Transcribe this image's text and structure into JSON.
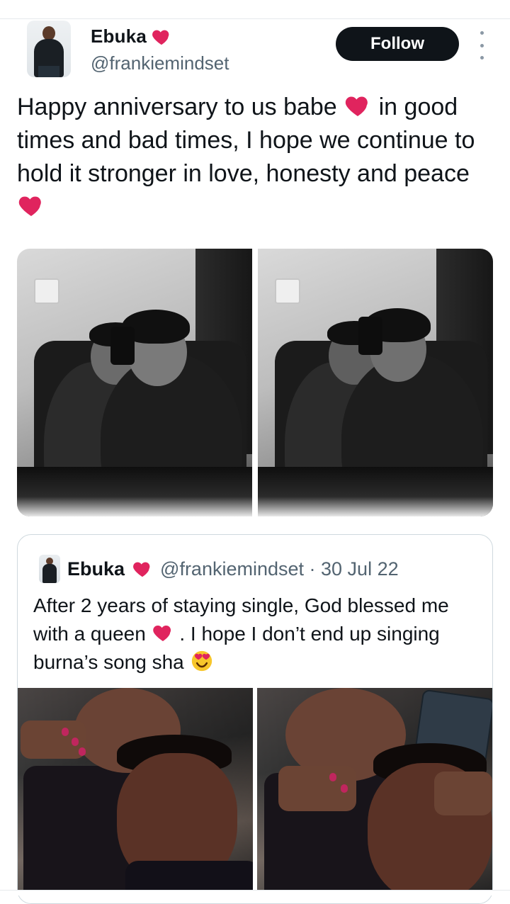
{
  "colors": {
    "heart": "#e0245e",
    "follow_bg": "#0f1419",
    "follow_text": "#ffffff",
    "secondary_text": "#536471",
    "border": "#cfd9de"
  },
  "header": {
    "name": "Ebuka",
    "handle": "@frankiemindset",
    "follow_label": "Follow",
    "heart_icon": "red-heart-icon",
    "more_icon": "more-vertical-icon"
  },
  "tweet": {
    "text_part1": "Happy anniversary to us babe",
    "text_part2": "in good times and bad times, I hope we continue to hold it stronger in love, honesty and peace",
    "inline_heart_icon": "red-heart-icon"
  },
  "quote": {
    "name": "Ebuka",
    "handle_date": "@frankiemindset · 30 Jul 22",
    "text_part1": "After 2 years of staying single, God blessed me with a queen",
    "text_part2": ". I hope I don’t end up singing burna’s song sha",
    "heart_icon": "red-heart-icon",
    "emoji_icon": "heart-eyes-emoji-icon"
  }
}
